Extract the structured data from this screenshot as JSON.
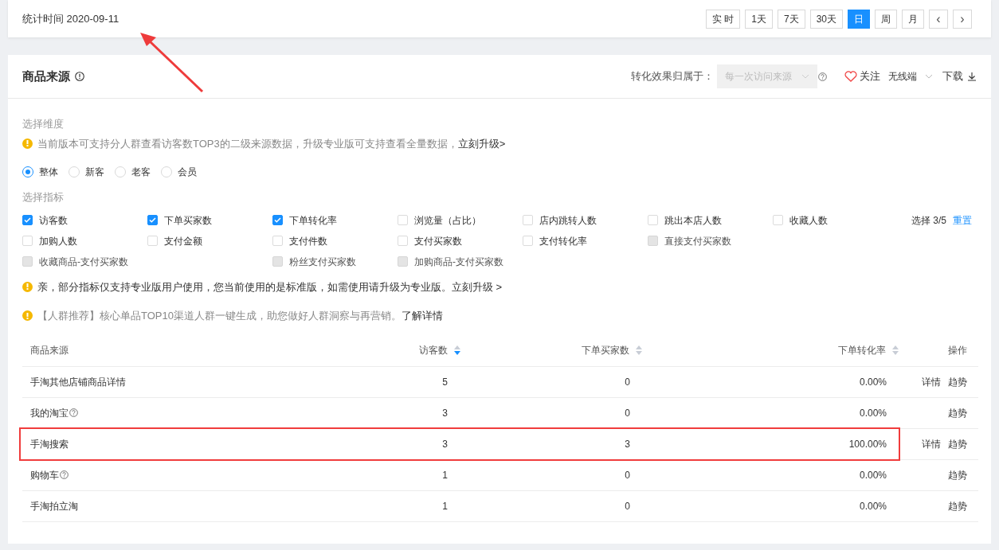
{
  "header": {
    "stat_time": "统计时间 2020-09-11",
    "ranges": [
      {
        "label": "实 时",
        "selected": false
      },
      {
        "label": "1天",
        "selected": false
      },
      {
        "label": "7天",
        "selected": false
      },
      {
        "label": "30天",
        "selected": false
      },
      {
        "label": "日",
        "selected": true
      },
      {
        "label": "周",
        "selected": false
      },
      {
        "label": "月",
        "selected": false
      }
    ],
    "prev": "‹",
    "next": "›"
  },
  "section": {
    "title": "商品来源",
    "attribution_label": "转化效果归属于：",
    "attribution_select": {
      "value": "每一次访问来源",
      "disabled": true
    },
    "follow": "关注",
    "device": "无线端",
    "download": "下载"
  },
  "dimension": {
    "label": "选择维度",
    "notice": "当前版本可支持分人群查看访客数TOP3的二级来源数据，升级专业版可支持查看全量数据，",
    "notice_link": "立刻升级>",
    "options": [
      {
        "label": "整体",
        "selected": true
      },
      {
        "label": "新客",
        "selected": false
      },
      {
        "label": "老客",
        "selected": false
      },
      {
        "label": "会员",
        "selected": false
      }
    ]
  },
  "metrics": {
    "label": "选择指标",
    "count": "选择 3/5",
    "reset": "重置",
    "rows": [
      [
        {
          "label": "访客数",
          "checked": true,
          "disabled": false
        },
        {
          "label": "下单买家数",
          "checked": true,
          "disabled": false
        },
        {
          "label": "下单转化率",
          "checked": true,
          "disabled": false
        },
        {
          "label": "浏览量（占比）",
          "checked": false,
          "disabled": false
        },
        {
          "label": "店内跳转人数",
          "checked": false,
          "disabled": false
        },
        {
          "label": "跳出本店人数",
          "checked": false,
          "disabled": false
        },
        {
          "label": "收藏人数",
          "checked": false,
          "disabled": false
        }
      ],
      [
        {
          "label": "加购人数",
          "checked": false,
          "disabled": false
        },
        {
          "label": "支付金额",
          "checked": false,
          "disabled": false
        },
        {
          "label": "支付件数",
          "checked": false,
          "disabled": false
        },
        {
          "label": "支付买家数",
          "checked": false,
          "disabled": false
        },
        {
          "label": "支付转化率",
          "checked": false,
          "disabled": false
        },
        {
          "label": "直接支付买家数",
          "checked": false,
          "disabled": true
        }
      ],
      [
        {
          "label": "收藏商品-支付买家数",
          "checked": false,
          "disabled": true
        },
        "",
        {
          "label": "粉丝支付买家数",
          "checked": false,
          "disabled": true
        },
        {
          "label": "加购商品-支付买家数",
          "checked": false,
          "disabled": true
        }
      ]
    ],
    "notice": "亲，部分指标仅支持专业版用户使用，您当前使用的是标准版，如需使用请升级为专业版。",
    "notice_link": "立刻升级 >"
  },
  "promo": {
    "text": "【人群推荐】核心单品TOP10渠道人群一键生成，助您做好人群洞察与再营销。",
    "link": "了解详情"
  },
  "table": {
    "columns": [
      {
        "label": "商品来源",
        "kind": "plain"
      },
      {
        "label": "访客数",
        "kind": "sort",
        "sorted": true
      },
      {
        "label": "下单买家数",
        "kind": "sort",
        "sorted": false
      },
      {
        "label": "下单转化率",
        "kind": "sort",
        "sorted": false
      },
      {
        "label": "操作",
        "kind": "plain"
      }
    ],
    "rows": [
      {
        "source": "手淘其他店铺商品详情",
        "help": false,
        "visitors": "5",
        "buyers": "0",
        "rate": "0.00%",
        "actions": [
          "详情",
          "趋势"
        ],
        "highlighted": false
      },
      {
        "source": "我的淘宝",
        "help": true,
        "visitors": "3",
        "buyers": "0",
        "rate": "0.00%",
        "actions": [
          "趋势"
        ],
        "highlighted": false
      },
      {
        "source": "手淘搜索",
        "help": false,
        "visitors": "3",
        "buyers": "3",
        "rate": "100.00%",
        "actions": [
          "详情",
          "趋势"
        ],
        "highlighted": true
      },
      {
        "source": "购物车",
        "help": true,
        "visitors": "1",
        "buyers": "0",
        "rate": "0.00%",
        "actions": [
          "趋势"
        ],
        "highlighted": false
      },
      {
        "source": "手淘拍立淘",
        "help": false,
        "visitors": "1",
        "buyers": "0",
        "rate": "0.00%",
        "actions": [
          "趋势"
        ],
        "highlighted": false
      }
    ]
  },
  "annotation": {
    "arrow": true
  }
}
